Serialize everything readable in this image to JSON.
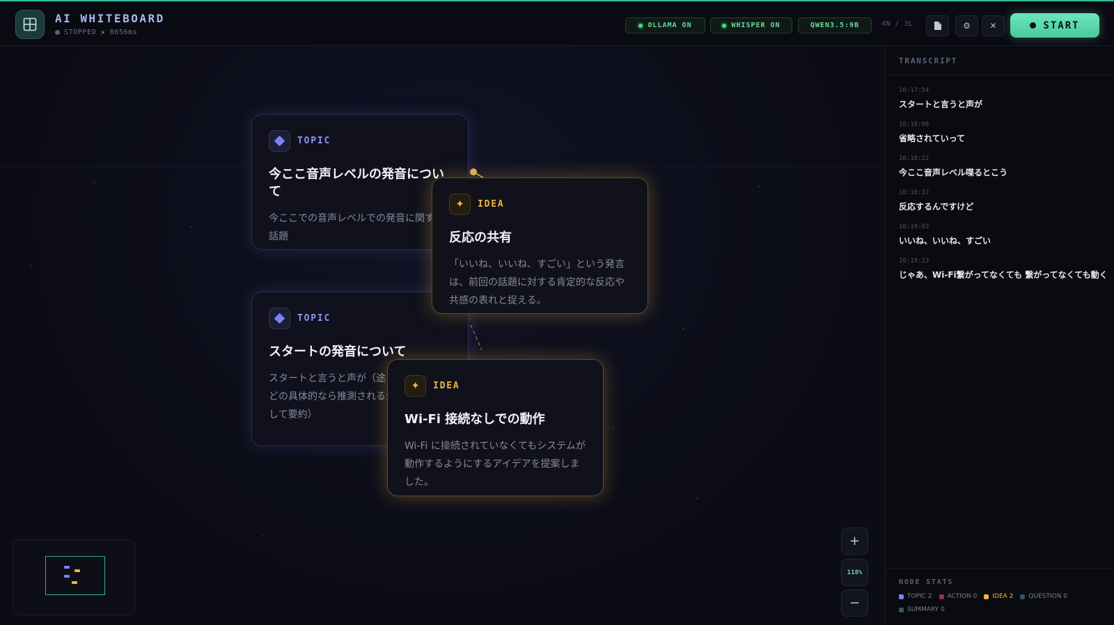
{
  "header": {
    "title": "AI WHITEBOARD",
    "status": "STOPPED",
    "latency": "8656ms",
    "pills": {
      "ollama": "OLLAMA ON",
      "whisper": "WHISPER ON",
      "model": "QWEN3.5:9B"
    },
    "counts": "4N / 3L",
    "start_label": "START"
  },
  "canvas": {
    "nodes": [
      {
        "type_label": "TOPIC",
        "title": "今ここ音声レベルの発音について",
        "body": "今ここでの音声レベルでの発音に関する話題"
      },
      {
        "type_label": "IDEA",
        "title": "反応の共有",
        "body": "「いいね、いいね、すごい」という発言は、前回の話題に対する肯定的な反応や共感の表れと捉える。"
      },
      {
        "type_label": "TOPIC",
        "title": "スタートの発音について",
        "body": "スタートと言うと声が（途る・出ないなどの具体的なら推測されるが、ここでは して要約）"
      },
      {
        "type_label": "IDEA",
        "title": "Wi-Fi 接続なしでの動作",
        "body": "Wi-Fi に接続されていなくてもシステムが動作するようにするアイデアを提案しました。"
      }
    ],
    "zoom": "118%",
    "zoom_in_label": "+",
    "zoom_out_label": "−"
  },
  "transcript": {
    "title": "TRANSCRIPT",
    "entries": [
      {
        "time": "10:17:54",
        "text": "スタートと言うと声が"
      },
      {
        "time": "10:18:08",
        "text": "省略されていって"
      },
      {
        "time": "10:18:22",
        "text": "今ここ音声レベル喋るとこう"
      },
      {
        "time": "10:18:37",
        "text": "反応するんですけど"
      },
      {
        "time": "10:19:03",
        "text": "いいね、いいね、すごい"
      },
      {
        "time": "10:19:23",
        "text": "じゃあ、Wi-Fi繋がってなくても 繋がってなくても動く"
      }
    ]
  },
  "stats": {
    "title": "NODE STATS",
    "items": [
      {
        "label": "TOPIC 2",
        "color": "#7d82f2"
      },
      {
        "label": "ACTION 0",
        "color": "#8a3a4a"
      },
      {
        "label": "IDEA 2",
        "color": "#f1b43a"
      },
      {
        "label": "QUESTION 0",
        "color": "#35506a"
      },
      {
        "label": "SUMMARY 0",
        "color": "#2f5e45"
      }
    ]
  },
  "colors": {
    "accent": "#49c99b",
    "topic": "#7d82f2",
    "idea": "#f1b43a"
  }
}
